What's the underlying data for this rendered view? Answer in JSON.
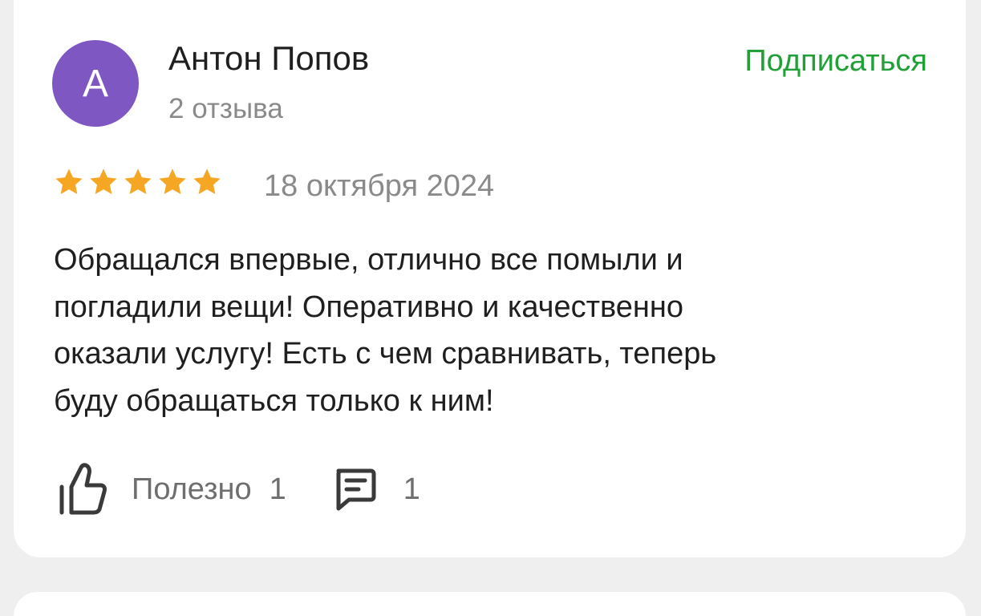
{
  "review": {
    "author": {
      "initial": "А",
      "name": "Антон Попов",
      "reviews_count": "2 отзыва",
      "avatar_color": "#7e57c2"
    },
    "subscribe_label": "Подписаться",
    "subscribe_color": "#21a038",
    "rating": 5,
    "rating_max": 5,
    "star_color": "#f5a623",
    "date": "18 октября 2024",
    "text": "Обращался впервые, отлично все помыли и\nпогладили вещи! Оперативно и качественно\nоказали услугу! Есть с чем сравнивать, теперь\nбуду обращаться только к ним!",
    "helpful": {
      "icon": "thumbs-up-icon",
      "label": "Полезно",
      "count": "1"
    },
    "comments": {
      "icon": "comment-icon",
      "count": "1"
    }
  }
}
